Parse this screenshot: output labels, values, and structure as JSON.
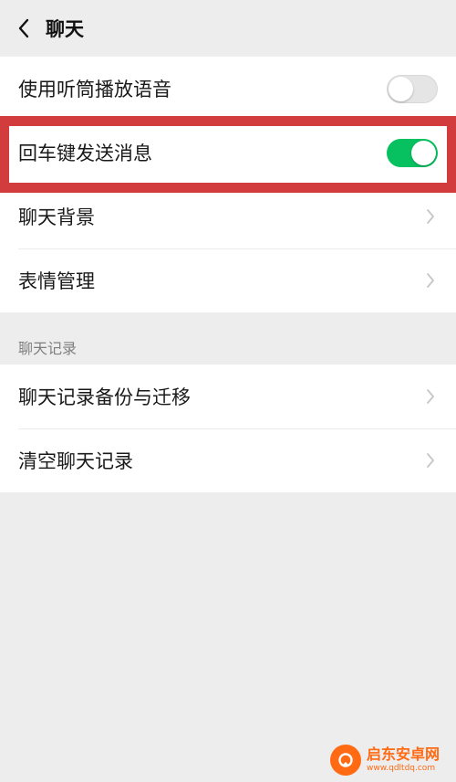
{
  "header": {
    "title": "聊天"
  },
  "group1": {
    "items": [
      {
        "label": "使用听筒播放语音",
        "toggle": "off"
      },
      {
        "label": "回车键发送消息",
        "toggle": "on"
      },
      {
        "label": "聊天背景"
      },
      {
        "label": "表情管理"
      }
    ]
  },
  "section": {
    "header": "聊天记录"
  },
  "group2": {
    "items": [
      {
        "label": "聊天记录备份与迁移"
      },
      {
        "label": "清空聊天记录"
      }
    ]
  },
  "watermark": {
    "name": "启东安卓网",
    "url": "www.qdltdq.com"
  },
  "colors": {
    "toggle_on": "#07c160",
    "highlight": "#d23c3c",
    "background": "#ededed",
    "watermark": "#ff6a13"
  },
  "icons": {
    "back": "chevron-left-icon",
    "chevron": "chevron-right-icon"
  }
}
